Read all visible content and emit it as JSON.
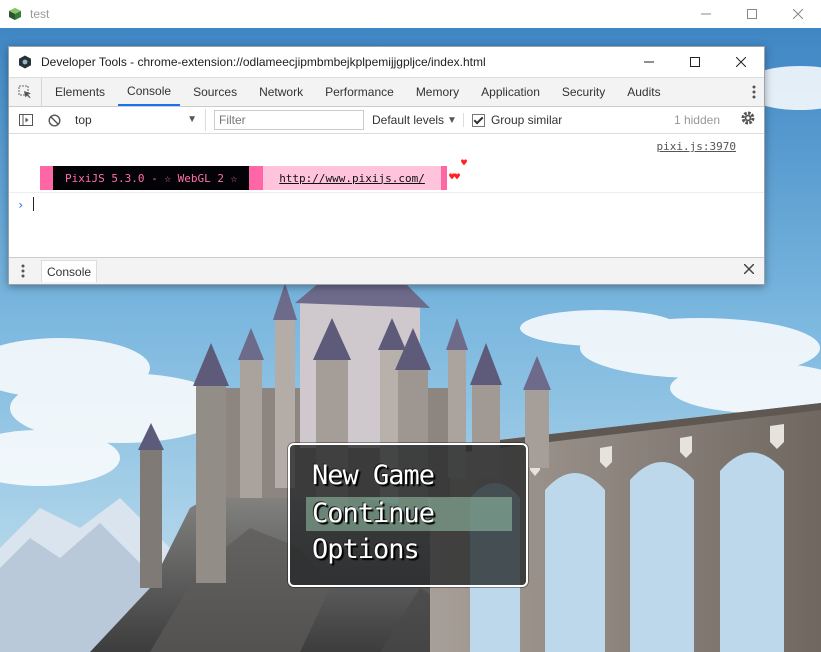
{
  "game_window": {
    "title": "test"
  },
  "devtools": {
    "title": "Developer Tools - chrome-extension://odlameecjipmbmbejkplpemijjgpljce/index.html",
    "tabs": [
      {
        "label": "Elements",
        "active": false
      },
      {
        "label": "Console",
        "active": true
      },
      {
        "label": "Sources",
        "active": false
      },
      {
        "label": "Network",
        "active": false
      },
      {
        "label": "Performance",
        "active": false
      },
      {
        "label": "Memory",
        "active": false
      },
      {
        "label": "Application",
        "active": false
      },
      {
        "label": "Security",
        "active": false
      },
      {
        "label": "Audits",
        "active": false
      }
    ],
    "toolbar": {
      "context": "top",
      "filter_placeholder": "Filter",
      "levels": "Default levels",
      "group_similar": "Group similar",
      "hidden_count": "1 hidden"
    },
    "console": {
      "source_link": "pixi.js:3970",
      "banner_text": "PixiJS 5.3.0 - ☆ WebGL 2 ☆",
      "banner_link": "http://www.pixijs.com/",
      "hearts": "♥♥",
      "heart_top": "♥",
      "prompt": "›"
    },
    "drawer": {
      "tab": "Console"
    },
    "colors": {
      "accent": "#1a73e8",
      "banner_pink": "#ff66a5",
      "banner_light": "#ffc3dc",
      "banner_dark": "#030307"
    }
  },
  "title_menu": {
    "commands": [
      {
        "label": "New Game",
        "selected": false
      },
      {
        "label": "Continue",
        "selected": true
      },
      {
        "label": "Options",
        "selected": false
      }
    ]
  }
}
